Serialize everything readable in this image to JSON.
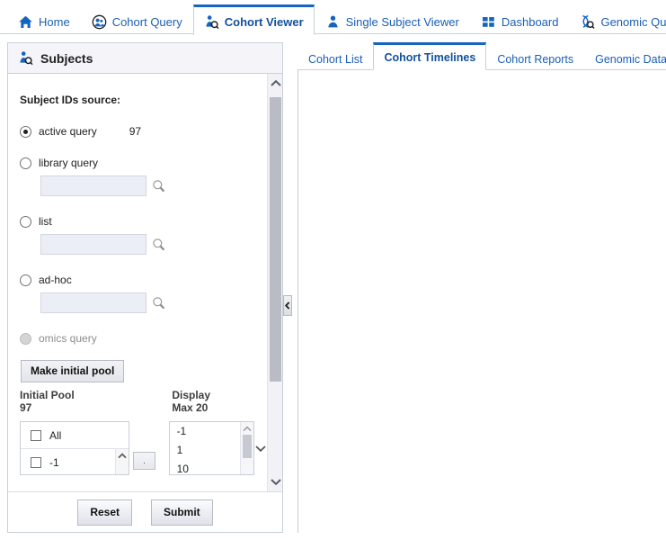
{
  "topnav": {
    "items": [
      {
        "label": "Home",
        "icon": "home-icon",
        "active": false
      },
      {
        "label": "Cohort Query",
        "icon": "cohort-query-icon",
        "active": false
      },
      {
        "label": "Cohort Viewer",
        "icon": "cohort-viewer-icon",
        "active": true
      },
      {
        "label": "Single Subject Viewer",
        "icon": "single-subject-icon",
        "active": false
      },
      {
        "label": "Dashboard",
        "icon": "dashboard-icon",
        "active": false
      },
      {
        "label": "Genomic Query",
        "icon": "genomic-query-icon",
        "active": false
      }
    ]
  },
  "left_panel": {
    "title": "Subjects",
    "title_icon": "subjects-icon",
    "source_label": "Subject IDs source:",
    "options": [
      {
        "label": "active query",
        "checked": true,
        "disabled": false,
        "count": "97",
        "has_input": false
      },
      {
        "label": "library query",
        "checked": false,
        "disabled": false,
        "has_input": true,
        "input_value": "",
        "input_placeholder": ""
      },
      {
        "label": "list",
        "checked": false,
        "disabled": false,
        "has_input": true,
        "input_value": "",
        "input_placeholder": ""
      },
      {
        "label": "ad-hoc",
        "checked": false,
        "disabled": false,
        "has_input": true,
        "input_value": "",
        "input_placeholder": ""
      },
      {
        "label": "omics query",
        "checked": false,
        "disabled": true,
        "has_input": false
      }
    ],
    "make_pool_label": "Make initial pool",
    "initial_pool_head_1": "Initial Pool",
    "initial_pool_head_2": "97",
    "display_head_1": "Display",
    "display_head_2": "Max 20",
    "pool_items": [
      {
        "label": "All",
        "checked": false
      },
      {
        "label": "-1",
        "checked": false
      }
    ],
    "display_items": [
      {
        "label": "-1"
      },
      {
        "label": "1"
      },
      {
        "label": "10"
      }
    ],
    "move_button_label": "·",
    "reset_label": "Reset",
    "submit_label": "Submit"
  },
  "right_panel": {
    "tabs": [
      {
        "label": "Cohort List",
        "active": false
      },
      {
        "label": "Cohort Timelines",
        "active": true
      },
      {
        "label": "Cohort Reports",
        "active": false
      },
      {
        "label": "Genomic Data Export",
        "active": false
      }
    ]
  },
  "colors": {
    "accent": "#1565c0",
    "link": "#1a5fb4",
    "border": "#c7d0d9",
    "header_bg": "#f4f4f9",
    "input_bg": "#eceef5"
  }
}
